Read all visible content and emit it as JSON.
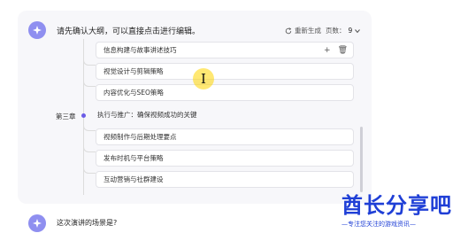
{
  "header": {
    "prompt": "请先确认大纲，可以直接点击进行编辑。",
    "regenerate_label": "重新生成",
    "pages_label": "页数：",
    "pages_value": "9"
  },
  "outline": {
    "top_item": "信息构建与故事讲述技巧",
    "items_before": [
      "视觉设计与剪辑策略",
      "内容优化与SEO策略"
    ],
    "chapter_label": "第三章",
    "chapter_title": "执行与推广：确保视频成功的关键",
    "items_after": [
      "视频制作与后期处理要点",
      "发布时机与平台策略",
      "互动营销与社群建设"
    ],
    "actions": {
      "add": "+",
      "delete": "🗑"
    }
  },
  "next_prompt": "这次演讲的场景是?",
  "watermark": {
    "title": "酋长分享吧",
    "subtitle": "—专注您关注的游戏资讯—"
  },
  "colors": {
    "accent": "#6b5ce7",
    "avatar": "#8f8ff0",
    "watermark": "#1f3fd6",
    "cursor_highlight": "#ffd600"
  }
}
